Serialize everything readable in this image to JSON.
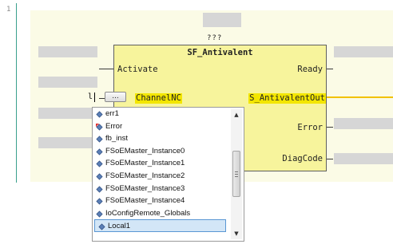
{
  "editor": {
    "line_number": "1",
    "instance_name_placeholder": "???",
    "typed_value": "l",
    "browse_button_label": "..."
  },
  "function_block": {
    "name": "SF_Antivalent",
    "inputs": [
      "Activate",
      "ChannelNC"
    ],
    "outputs": [
      "Ready",
      "S_AntivalentOut",
      "Error",
      "DiagCode"
    ]
  },
  "autocomplete": {
    "items": [
      {
        "label": "err1",
        "icon": "variable-icon"
      },
      {
        "label": "Error",
        "icon": "error-variable-icon"
      },
      {
        "label": "fb_inst",
        "icon": "variable-icon"
      },
      {
        "label": "FSoEMaster_Instance0",
        "icon": "variable-icon"
      },
      {
        "label": "FSoEMaster_Instance1",
        "icon": "variable-icon"
      },
      {
        "label": "FSoEMaster_Instance2",
        "icon": "variable-icon"
      },
      {
        "label": "FSoEMaster_Instance3",
        "icon": "variable-icon"
      },
      {
        "label": "FSoEMaster_Instance4",
        "icon": "variable-icon"
      },
      {
        "label": "IoConfigRemote_Globals",
        "icon": "variable-icon"
      },
      {
        "label": "Local1",
        "icon": "variable-icon",
        "selected": true
      }
    ]
  },
  "colors": {
    "canvas_bg": "#fbfbe6",
    "fb_fill": "#f7f49c",
    "highlight_pin": "#f3e600",
    "selection": "#d3e6f7"
  }
}
